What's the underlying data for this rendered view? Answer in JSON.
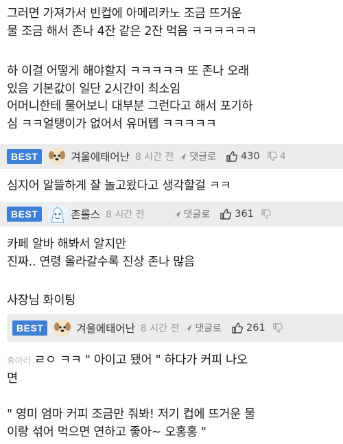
{
  "post": {
    "lines": [
      "그러면 가져가서 빈컵에 아메리카노 조금 뜨거운",
      "물 조금 해서 존나 4잔 같은 2잔 먹음 ㅋㅋㅋㅋㅋㅋ",
      "하 이걸 어떻게 해야할지 ㅋㅋㅋㅋㅋ 또 존나 오래",
      "있음 기본값이 일단 2시간이 최소임",
      "어머니한테 물어보니 대부분 그런다고 해서 포기하",
      "심 ㅋㅋ얼탱이가 없어서 유머텝 ㅋㅋㅋㅋㅋ"
    ]
  },
  "comments": [
    {
      "badge": "BEST",
      "username": "겨울에태어난",
      "time": "8 시간 전",
      "reply_label": "댓글로",
      "likes": "430",
      "dislikes": "4",
      "text": [
        "심지어 알뜰하게 잘 놀고왔다고 생각할걸 ㅋㅋ"
      ]
    },
    {
      "badge": "BEST",
      "username": "존롤스",
      "time": "8 시간 전",
      "reply_label": "댓글로",
      "likes": "361",
      "text": [
        "카페 알바 해봐서 알지만",
        "진짜.. 연령 올라갈수록 진상 존나 많음",
        "사장님 화이팅"
      ]
    },
    {
      "badge": "BEST",
      "username": "겨울에태어난",
      "time": "8 시간 전",
      "reply_label": "댓글로",
      "likes": "261",
      "text_prefix": "휴아라",
      "text": [
        "ㄹㅇ ㅋㅋ \" 아이고 됐어 \" 하다가 커피 나오",
        "면",
        "\" 영미 엄마 커피 조금만 줘봐! 저기 컵에 뜨거운 물",
        "이랑 섞어 먹으면 연하고 좋아~ 오홍홍 \""
      ]
    }
  ],
  "colors": {
    "badge": "#3f7fd6",
    "band": "#ececed"
  },
  "icons": [
    "dog-avatar-icon",
    "robot-avatar-icon",
    "reply-arrow-icon",
    "thumbs-up-icon",
    "thumbs-down-icon"
  ]
}
